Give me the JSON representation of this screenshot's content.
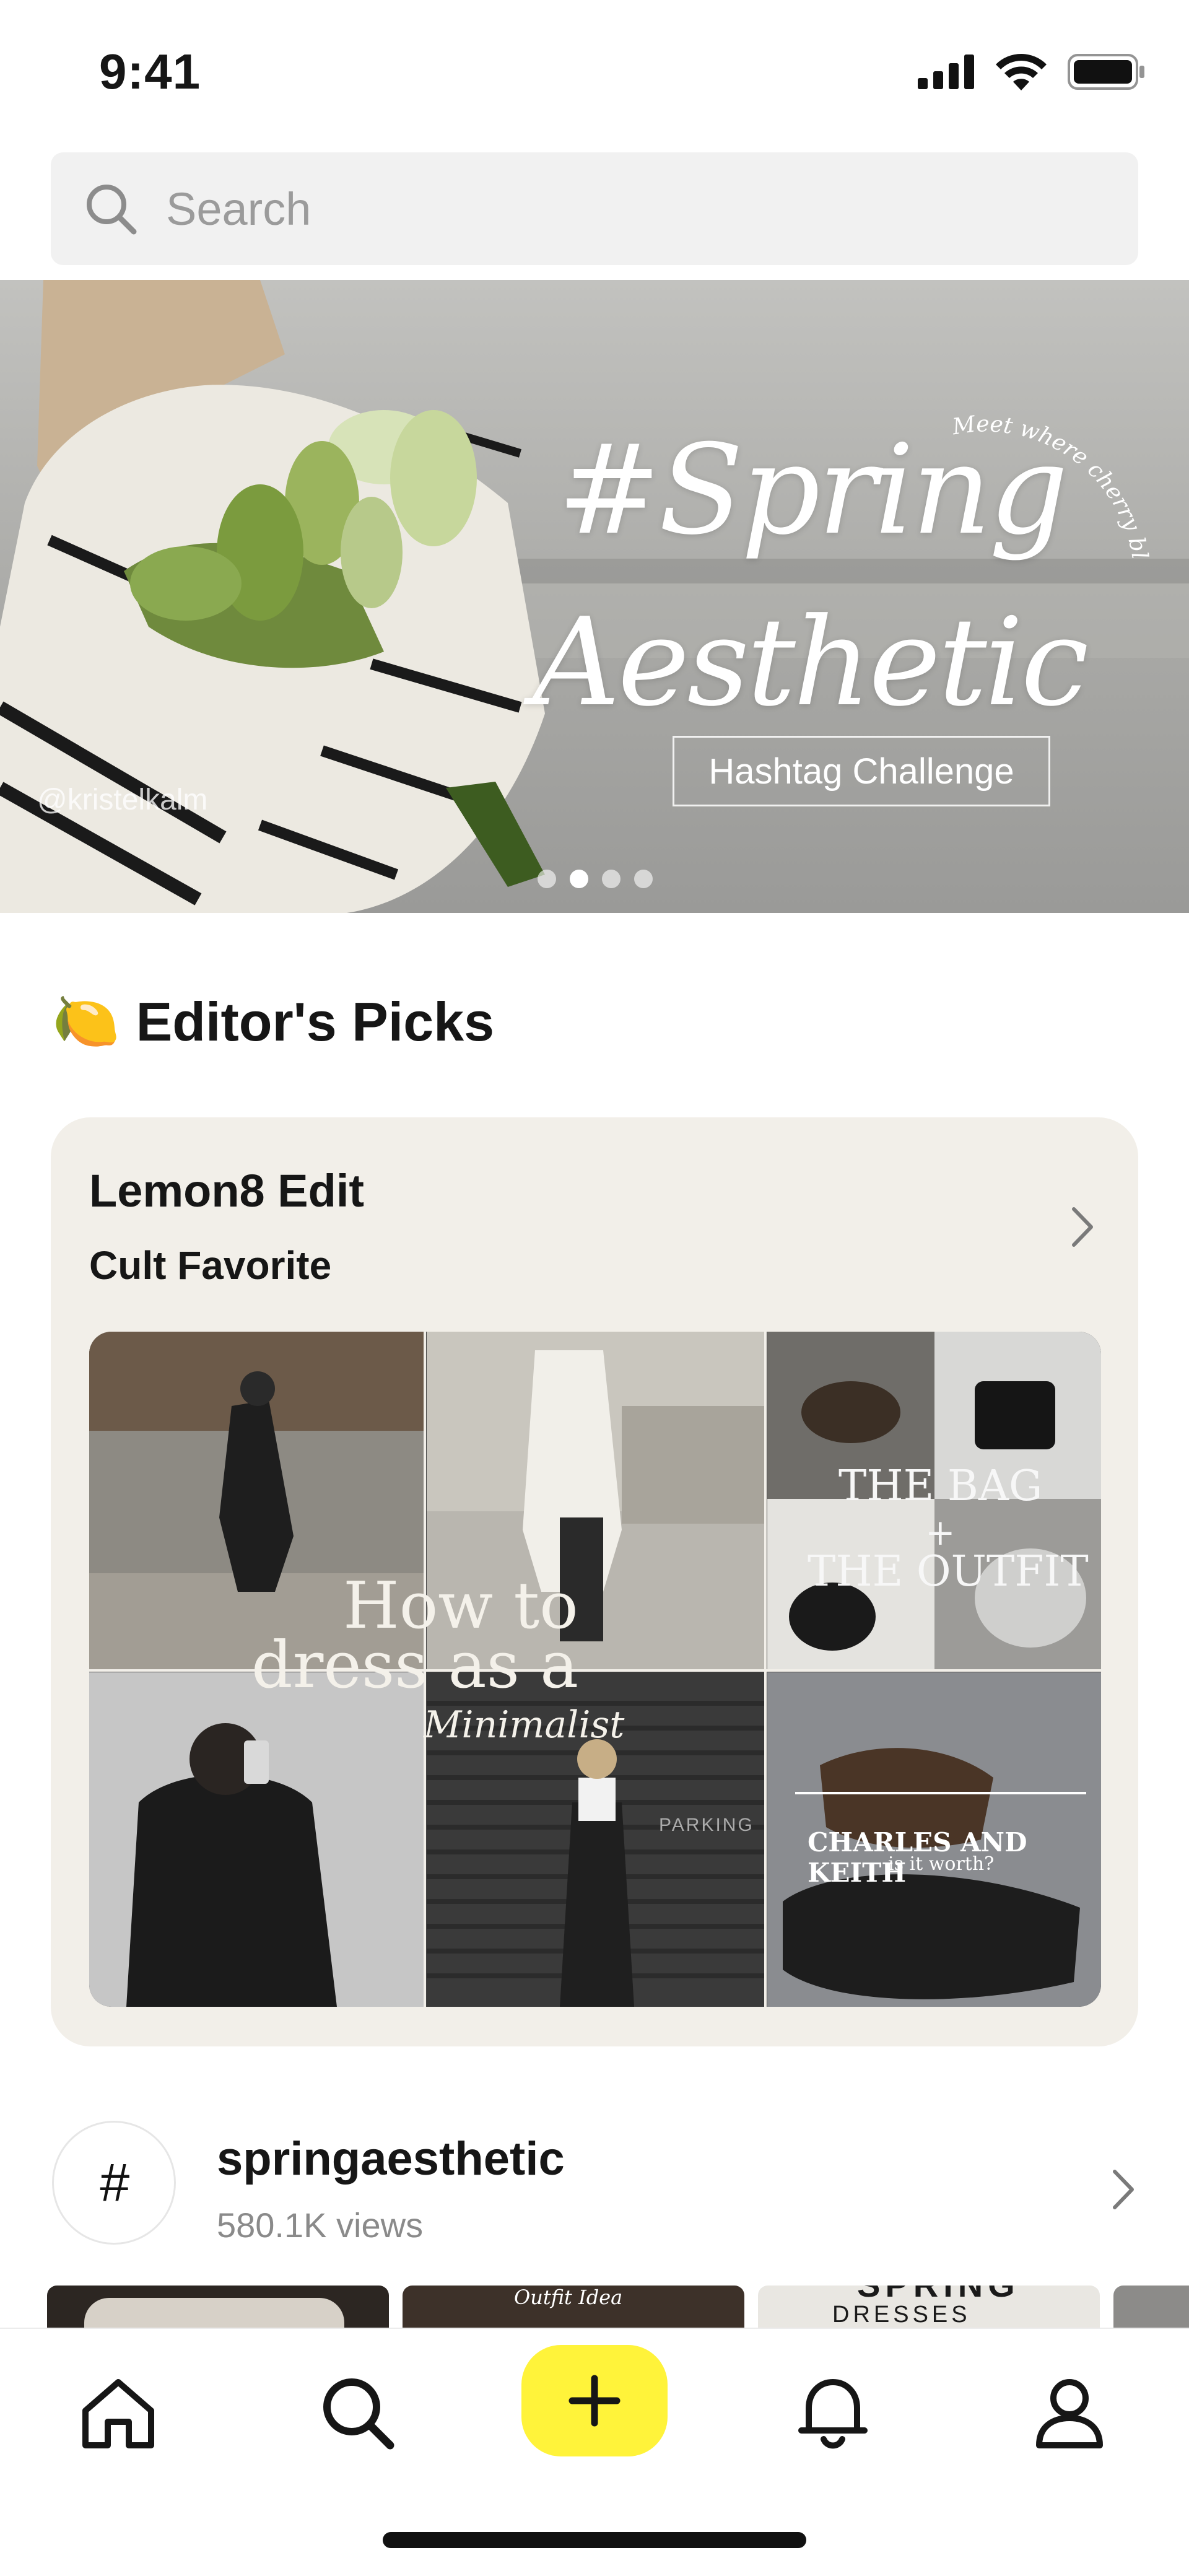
{
  "status_bar": {
    "time": "9:41"
  },
  "search": {
    "placeholder": "Search"
  },
  "banner": {
    "handle": "@kristelkalm",
    "headline_line1": "#Spring",
    "headline_line2": "Aesthetic",
    "arc_text": "Meet where cherry blossoms",
    "cta_label": "Hashtag Challenge",
    "dots_total": 4,
    "active_dot": 2
  },
  "editors_picks": {
    "emoji": "🍋",
    "title": "Editor's Picks",
    "card": {
      "title": "Lemon8 Edit",
      "subtitle": "Cult Favorite",
      "collage_text": {
        "how_to_line1": "How to",
        "how_to_line2": "dress as a",
        "minimalist": "Minimalist",
        "bag_line1": "THE BAG",
        "bag_plus": "+",
        "bag_line2": "THE OUTFIT",
        "ck_line1": "CHARLES AND KEITH",
        "ck_line2": "is it worth?",
        "parking": "PARKING"
      }
    }
  },
  "hashtag": {
    "symbol": "#",
    "name": "springaesthetic",
    "views": "580.1K views",
    "thumbnails": [
      {
        "label": ""
      },
      {
        "label": "Outfit Idea"
      },
      {
        "label": "SPRING",
        "sublabel": "DRESSES"
      },
      {
        "label": ""
      }
    ]
  },
  "bottom_nav": {
    "items": [
      {
        "name": "home",
        "icon": "home-icon"
      },
      {
        "name": "search",
        "icon": "search-icon"
      },
      {
        "name": "create",
        "icon": "plus-icon"
      },
      {
        "name": "notifications",
        "icon": "bell-icon"
      },
      {
        "name": "profile",
        "icon": "person-icon"
      }
    ],
    "create_color": "#fff33a"
  }
}
